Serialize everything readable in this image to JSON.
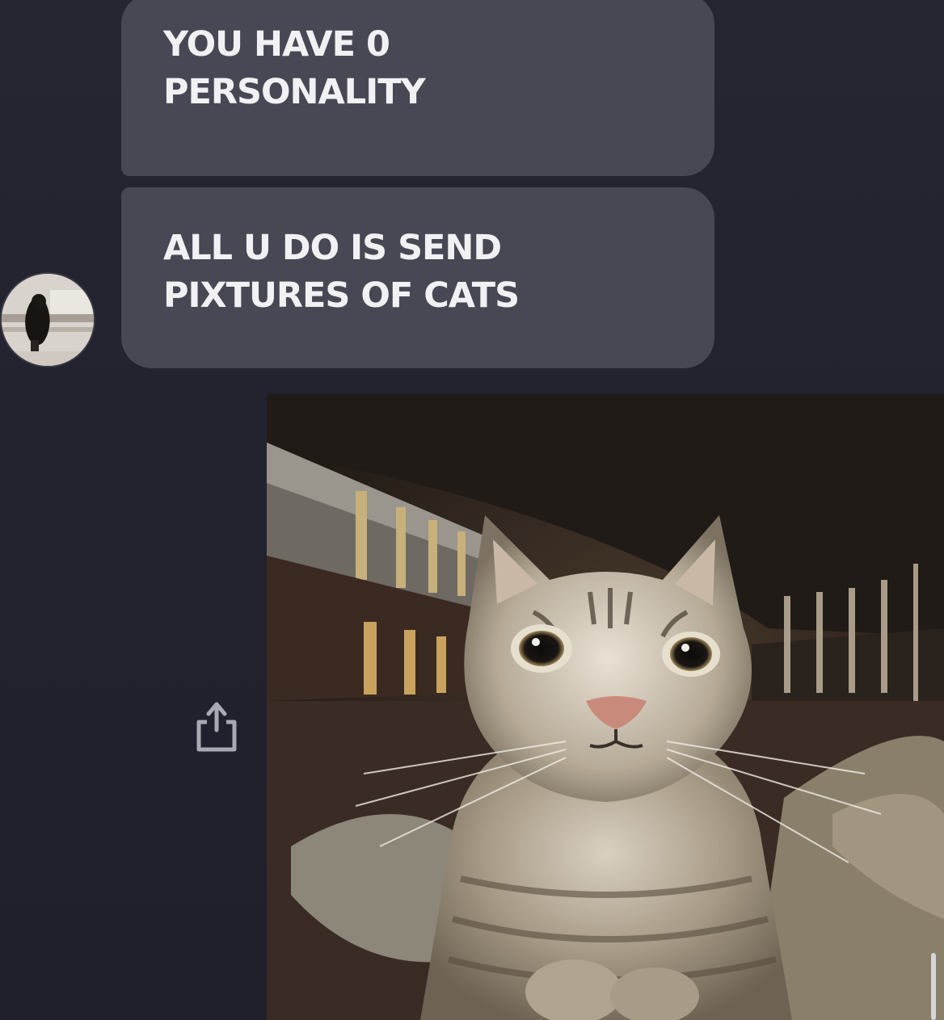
{
  "messages": [
    {
      "sender": "other",
      "lines": [
        "YOU HAVE 0",
        "PERSONALITY"
      ]
    },
    {
      "sender": "other",
      "lines": [
        "ALL U DO IS SEND",
        "PIXTURES OF CATS"
      ]
    }
  ],
  "attachment": {
    "type": "image",
    "subject": "cat-photo"
  },
  "icons": {
    "share": "share-icon",
    "avatar": "avatar"
  },
  "colors": {
    "background": "#23232f",
    "bubble": "#484855",
    "bubble_text": "#f1f1f3"
  }
}
